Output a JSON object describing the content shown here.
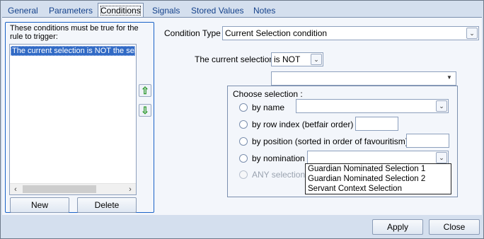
{
  "tabs": [
    "General",
    "Parameters",
    "Conditions",
    "Signals",
    "Stored Values",
    "Notes"
  ],
  "active_tab": "Conditions",
  "conditions_group": {
    "title": "These conditions must be true for the rule to trigger:",
    "items": [
      "The current selection is NOT the selection"
    ],
    "new_label": "New",
    "delete_label": "Delete"
  },
  "condition_type": {
    "label": "Condition Type",
    "value": "Current Selection condition"
  },
  "current_selection": {
    "label": "The current selection",
    "operator": "is NOT",
    "target_value": ""
  },
  "choose_selection": {
    "title": "Choose selection :",
    "options": [
      {
        "label": "by name"
      },
      {
        "label": "by row index (betfair order)"
      },
      {
        "label": "by position (sorted in order of favouritism)"
      },
      {
        "label": "by nomination"
      },
      {
        "label": "ANY selection"
      }
    ],
    "nomination_dropdown": [
      "Guardian Nominated Selection 1",
      "Guardian Nominated Selection 2",
      "Servant Context Selection"
    ]
  },
  "footer": {
    "apply_label": "Apply",
    "close_label": "Close"
  },
  "icons": {
    "move_up": "green-arrow-up-icon",
    "move_down": "green-arrow-down-icon"
  }
}
